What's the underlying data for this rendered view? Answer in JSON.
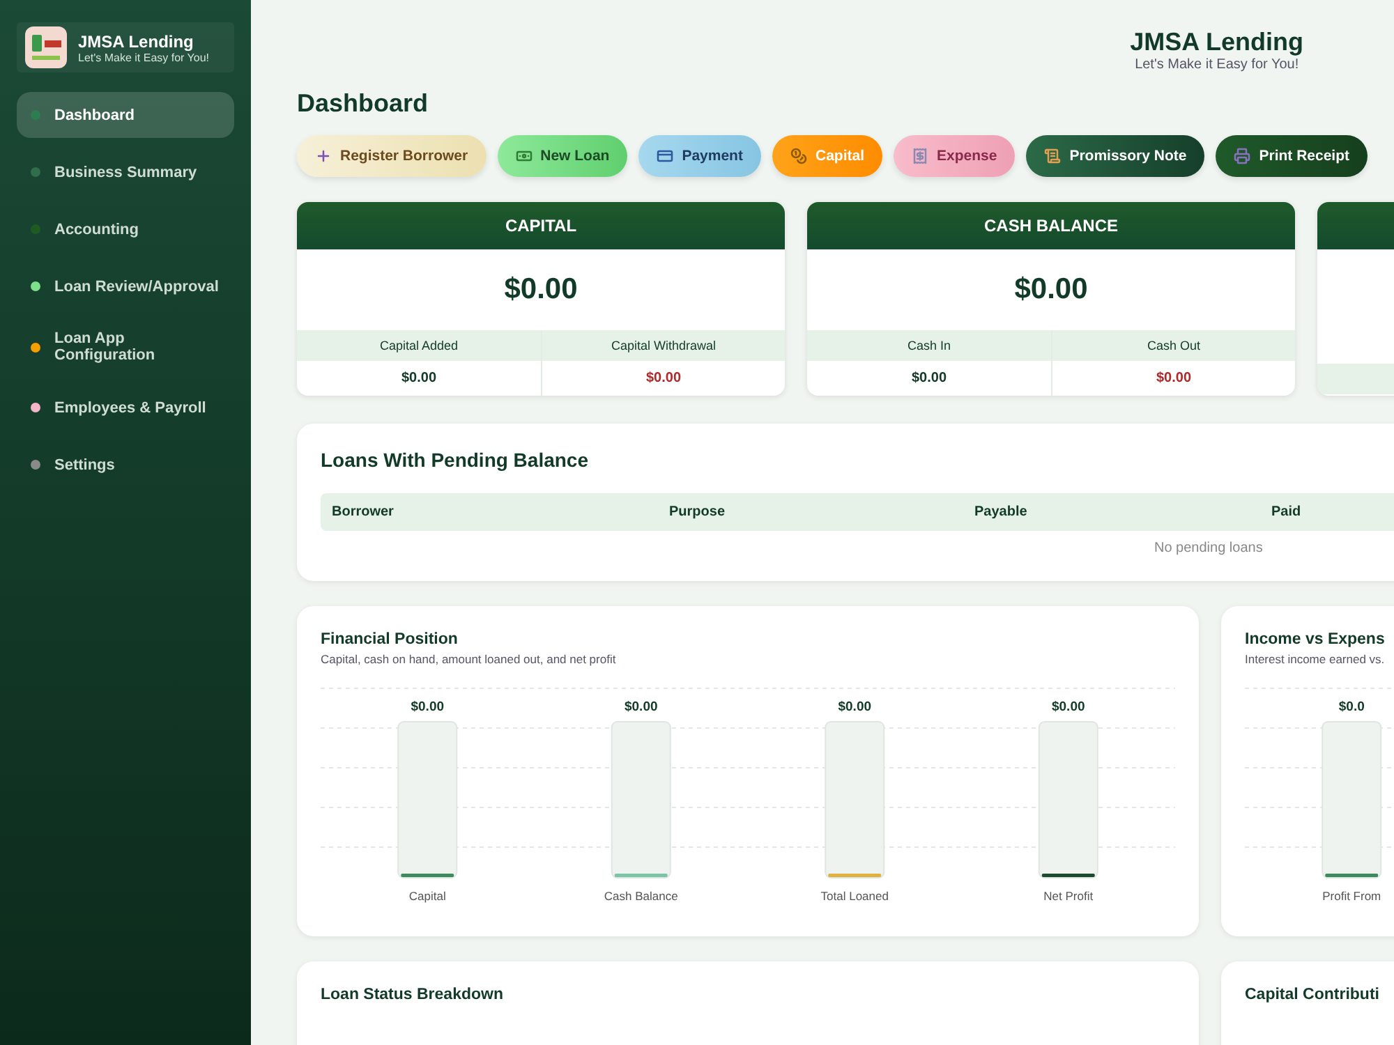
{
  "sidebar": {
    "brand": {
      "name": "JMSA Lending",
      "tagline": "Let's Make it Easy for You!"
    },
    "items": [
      {
        "label": "Dashboard",
        "selected": true,
        "color": "#2e7d4f"
      },
      {
        "label": "Business Summary",
        "selected": false,
        "color": "#2f6e4c"
      },
      {
        "label": "Accounting",
        "selected": false,
        "color": "#1f5a22"
      },
      {
        "label": "Loan Review/Approval",
        "selected": false,
        "color": "#7ee08a"
      },
      {
        "label": "Loan App Configuration",
        "selected": false,
        "color": "#f5a000"
      },
      {
        "label": "Employees & Payroll",
        "selected": false,
        "color": "#f4b6c8"
      },
      {
        "label": "Settings",
        "selected": false,
        "color": "#8a8a8a"
      }
    ]
  },
  "header": {
    "title": "JMSA Lending",
    "tagline": "Let's Make it Easy for You!"
  },
  "page_title": "Dashboard",
  "actions": [
    {
      "label": "Register Borrower",
      "kind": "register"
    },
    {
      "label": "New Loan",
      "kind": "loan"
    },
    {
      "label": "Payment",
      "kind": "payment"
    },
    {
      "label": "Capital",
      "kind": "capital"
    },
    {
      "label": "Expense",
      "kind": "expense"
    },
    {
      "label": "Promissory Note",
      "kind": "note"
    },
    {
      "label": "Print Receipt",
      "kind": "print"
    }
  ],
  "stat_cards": [
    {
      "title": "CAPITAL",
      "value": "$0.00",
      "sub": [
        {
          "label": "Capital Added",
          "value": "$0.00",
          "kind": "in"
        },
        {
          "label": "Capital Withdrawal",
          "value": "$0.00",
          "kind": "out"
        }
      ]
    },
    {
      "title": "CASH BALANCE",
      "value": "$0.00",
      "sub": [
        {
          "label": "Cash In",
          "value": "$0.00",
          "kind": "in"
        },
        {
          "label": "Cash Out",
          "value": "$0.00",
          "kind": "out"
        }
      ]
    },
    {
      "kind": "partial"
    }
  ],
  "pending_loans": {
    "title": "Loans With Pending Balance",
    "columns": [
      "Borrower",
      "Purpose",
      "Payable",
      "Paid"
    ],
    "empty_message": "No pending loans"
  },
  "charts": [
    {
      "title": "Financial Position",
      "subtitle": "Capital, cash on hand, amount loaned out, and net profit",
      "bars": [
        {
          "label": "Capital",
          "value": "$0.00"
        },
        {
          "label": "Cash Balance",
          "value": "$0.00"
        },
        {
          "label": "Total Loaned",
          "value": "$0.00"
        },
        {
          "label": "Net Profit",
          "value": "$0.00"
        }
      ]
    },
    {
      "title": "Income vs Expens",
      "subtitle": "Interest income earned vs.",
      "bars": [
        {
          "label": "Profit From",
          "value": "$0.0"
        }
      ]
    }
  ],
  "bottom_cards": [
    {
      "title": "Loan Status Breakdown"
    },
    {
      "title": "Capital Contributi"
    }
  ]
}
